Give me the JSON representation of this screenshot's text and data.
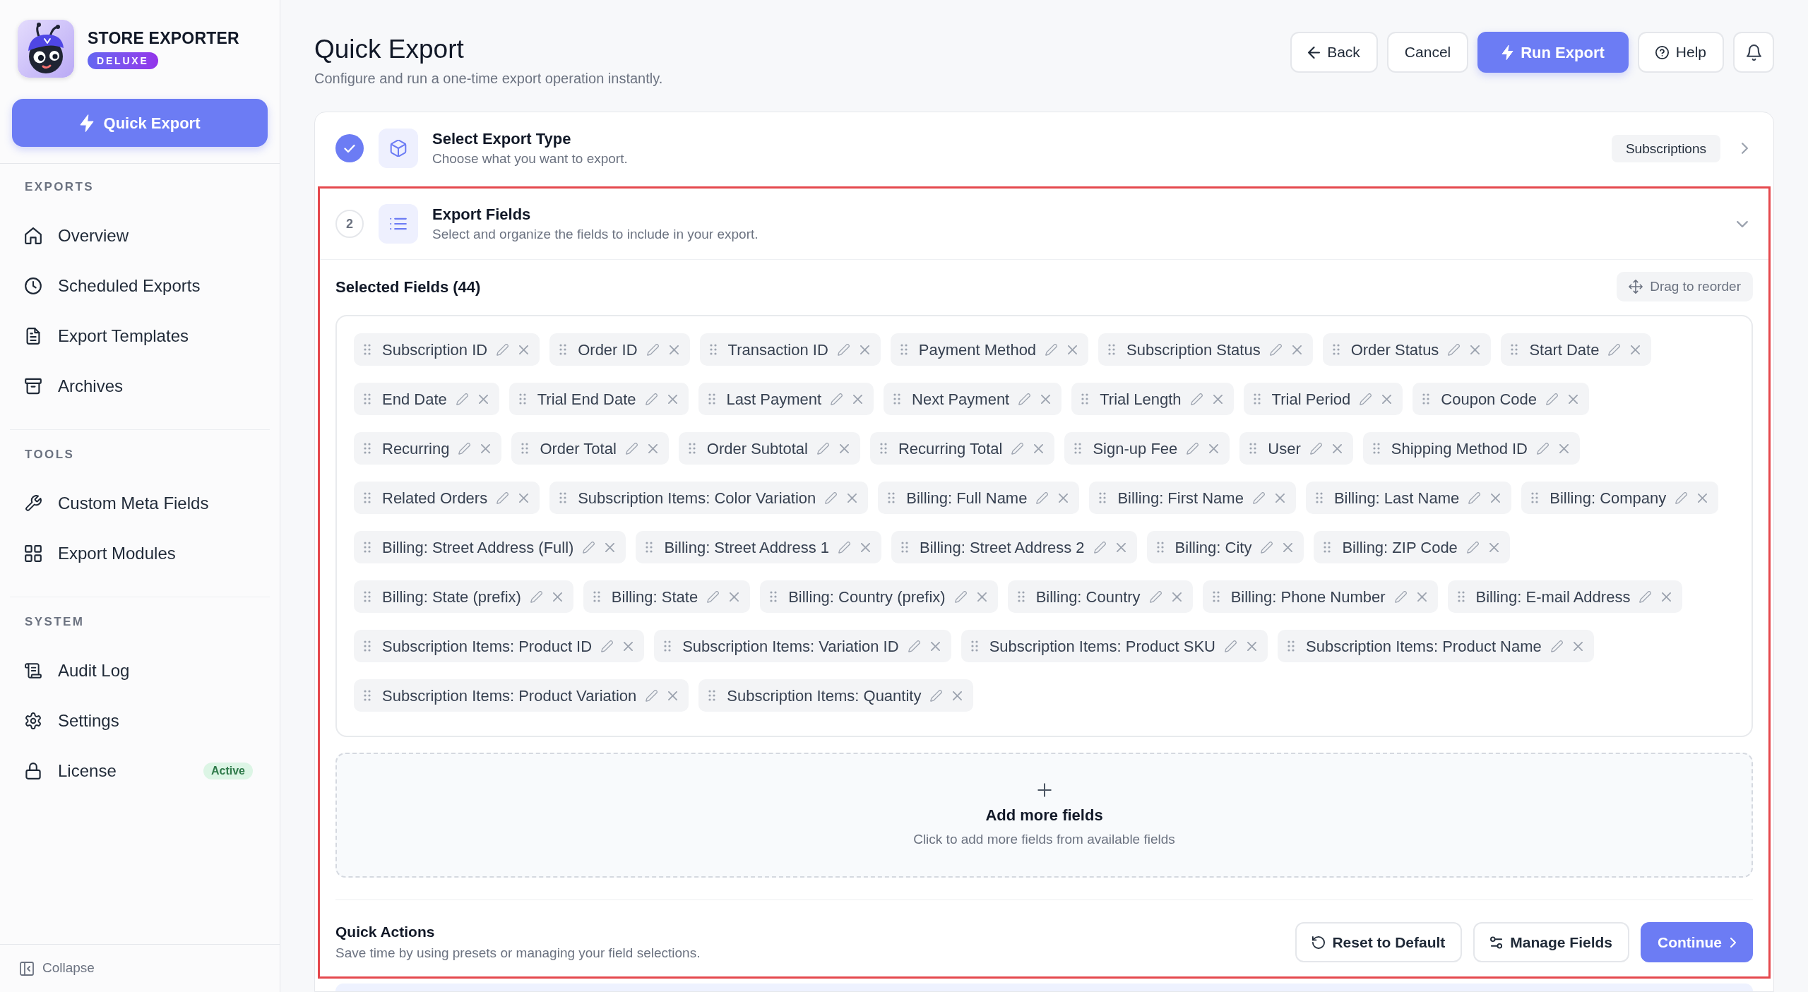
{
  "app": {
    "name": "STORE EXPORTER",
    "edition": "DELUXE"
  },
  "sidebar": {
    "primary_action": "Quick Export",
    "sections": [
      {
        "title": "EXPORTS",
        "items": [
          {
            "label": "Overview",
            "selected": false
          },
          {
            "label": "Scheduled Exports",
            "selected": false
          },
          {
            "label": "Export Templates",
            "selected": false
          },
          {
            "label": "Archives",
            "selected": false
          }
        ]
      },
      {
        "title": "TOOLS",
        "items": [
          {
            "label": "Custom Meta Fields",
            "selected": false
          },
          {
            "label": "Export Modules",
            "selected": false
          }
        ]
      },
      {
        "title": "SYSTEM",
        "items": [
          {
            "label": "Audit Log",
            "selected": false
          },
          {
            "label": "Settings",
            "selected": false
          },
          {
            "label": "License",
            "selected": false,
            "badge": "Active"
          }
        ]
      }
    ],
    "collapse": "Collapse"
  },
  "header": {
    "title": "Quick Export",
    "subtitle": "Configure and run a one-time export operation instantly.",
    "buttons": [
      {
        "label": "Back",
        "kind": "outline"
      },
      {
        "label": "Cancel",
        "kind": "outline"
      },
      {
        "label": "Run Export",
        "kind": "primary"
      },
      {
        "label": "Help",
        "kind": "outline"
      },
      {
        "kind": "icon"
      }
    ]
  },
  "steps": [
    {
      "title": "Select Export Type",
      "subtitle": "Choose what you want to export.",
      "completed": true,
      "expanded": false,
      "value": "Subscriptions"
    },
    {
      "number": "2",
      "title": "Export Fields",
      "subtitle": "Select and organize the fields to include in your export.",
      "completed": false,
      "expanded": true,
      "highlighted": true,
      "selected_fields": {
        "heading": "Selected Fields (44)",
        "reorder_button": "Drag to reorder",
        "fields": [
          "Subscription ID",
          "Order ID",
          "Transaction ID",
          "Payment Method",
          "Subscription Status",
          "Order Status",
          "Start Date",
          "End Date",
          "Trial End Date",
          "Last Payment",
          "Next Payment",
          "Trial Length",
          "Trial Period",
          "Coupon Code",
          "Recurring",
          "Order Total",
          "Order Subtotal",
          "Recurring Total",
          "Sign-up Fee",
          "User",
          "Shipping Method ID",
          "Related Orders",
          "Subscription Items: Color Variation",
          "Billing: Full Name",
          "Billing: First Name",
          "Billing: Last Name",
          "Billing: Company",
          "Billing: Street Address (Full)",
          "Billing: Street Address 1",
          "Billing: Street Address 2",
          "Billing: City",
          "Billing: ZIP Code",
          "Billing: State (prefix)",
          "Billing: State",
          "Billing: Country (prefix)",
          "Billing: Country",
          "Billing: Phone Number",
          "Billing: E-mail Address",
          "Subscription Items: Product ID",
          "Subscription Items: Variation ID",
          "Subscription Items: Product SKU",
          "Subscription Items: Product Name",
          "Subscription Items: Product Variation",
          "Subscription Items: Quantity"
        ]
      },
      "add_more": {
        "title": "Add more fields",
        "hint": "Click to add more fields from available fields"
      },
      "quick_actions": {
        "title": "Quick Actions",
        "subtitle": "Save time by using presets or managing your field selections.",
        "buttons": [
          {
            "label": "Reset to Default",
            "kind": "outline"
          },
          {
            "label": "Manage Fields",
            "kind": "outline"
          },
          {
            "label": "Continue",
            "kind": "primary"
          }
        ]
      }
    }
  ]
}
